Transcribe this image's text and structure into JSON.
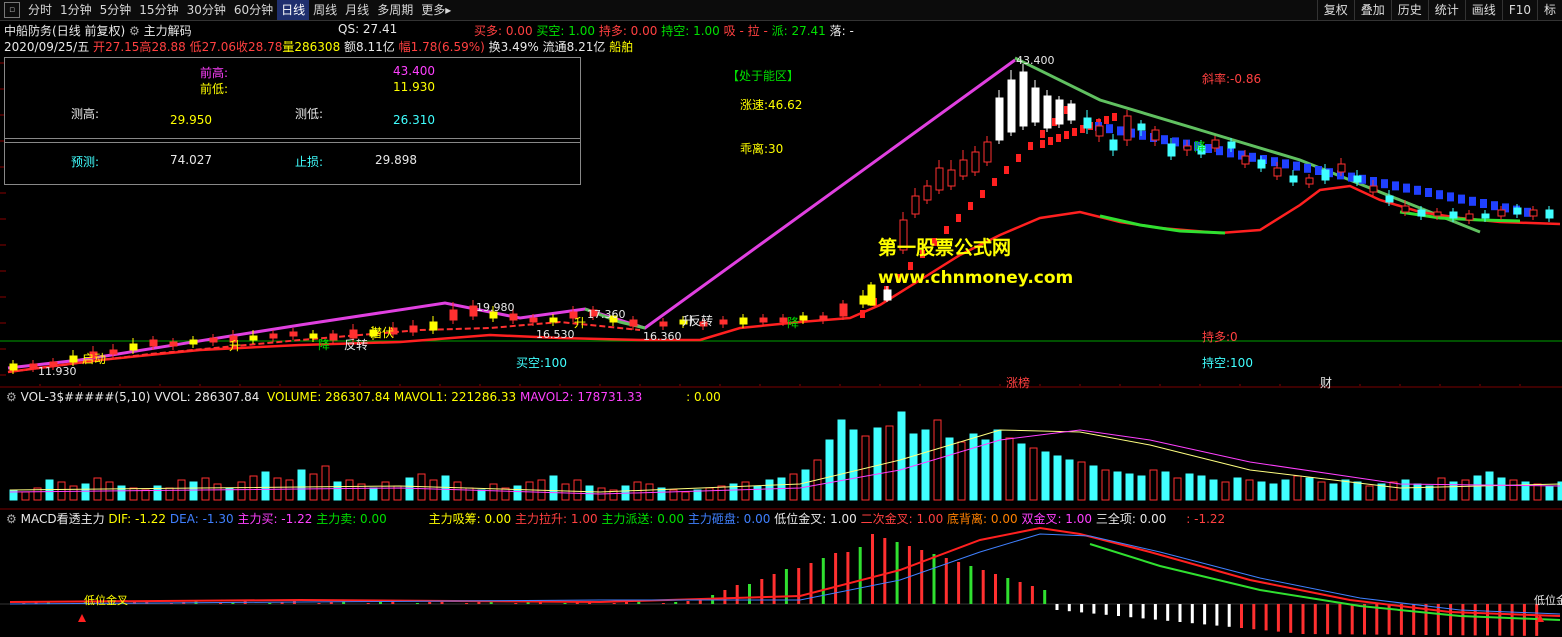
{
  "toolbar": {
    "timeframes": [
      "分时",
      "1分钟",
      "5分钟",
      "15分钟",
      "30分钟",
      "60分钟",
      "日线",
      "周线",
      "月线",
      "多周期",
      "更多▸"
    ],
    "active": "日线",
    "right": [
      "复权",
      "叠加",
      "历史",
      "统计",
      "画线",
      "F10",
      "标"
    ]
  },
  "header": {
    "stock": "中船防务",
    "mode": "(日线 前复权)",
    "indicator": "主力解码",
    "qs": "QS: 27.41",
    "buy_more": "买多: 0.00",
    "buy_empty": "买空: 1.00",
    "hold_more": "持多: 0.00",
    "hold_empty": "持空: 1.00",
    "xi": "吸",
    "la": "拉",
    "pai": "派: 27.41",
    "luo": "落: -"
  },
  "quote": {
    "date": "2020/09/25/五",
    "open_l": "开",
    "open": "27.15",
    "high_l": "高",
    "high": "28.88",
    "low_l": "低",
    "low": "27.06",
    "close_l": "收",
    "close": "28.78",
    "vol_l": "量",
    "vol": "286308",
    "amt_l": "额",
    "amt": "8.11亿",
    "chg_l": "幅",
    "chg": "1.78(6.59%)",
    "turn_l": "换",
    "turn": "3.49%",
    "float_l": "流通",
    "float": "8.21亿",
    "sector": "船舶"
  },
  "panel": {
    "prev_high_label": "前高:",
    "prev_high": "43.400",
    "prev_low_label": "前低:",
    "prev_low": "11.930",
    "m_high_label": "测高:",
    "m_high": "29.950",
    "m_low_label": "测低:",
    "m_low": "26.310",
    "predict_label": "预测:",
    "predict": "74.027",
    "stop_label": "止损:",
    "stop": "29.898"
  },
  "chart_labels": {
    "zone": "【处于能区】",
    "speed": "涨速:46.62",
    "deviation": "乖离:30",
    "slope": "斜率:-0.86",
    "hold_more": "持多:0",
    "buy_empty": "买空:100",
    "hold_empty": "持空:100",
    "peak": "43.400",
    "p1": "19.980",
    "p2": "17.360",
    "p3": "16.530",
    "p4": "16.360",
    "p5": "11.930",
    "event1": "涨榜",
    "event2": "财",
    "t_fall": "下跌",
    "t_rise": "升",
    "t_turn": "反转",
    "t_drop": "降",
    "t_latent": "潜伏",
    "t_buy": "买",
    "t_start": "启动"
  },
  "watermark": {
    "line1": "第一股票公式网",
    "line2": "www.chnmoney.com"
  },
  "vol_panel": {
    "name": "VOL-3$#####(5,10)",
    "vvol": "VVOL: 286307.84",
    "volume": "VOLUME: 286307.84",
    "mavol1": "MAVOL1: 221286.33",
    "mavol2": "MAVOL2: 178731.33",
    "extra": ": 0.00"
  },
  "macd_panel": {
    "name": "MACD看透主力",
    "dif": "DIF: -1.22",
    "dea": "DEA: -1.30",
    "zl_buy": "主力买: -1.22",
    "zl_sell": "主力卖: 0.00",
    "xichou": "主力吸筹: 0.00",
    "lasheng": "主力拉升: 1.00",
    "paisong": "主力派送: 0.00",
    "zapan": "主力砸盘: 0.00",
    "low_gold": "低位金叉: 1.00",
    "second_gold": "二次金叉: 1.00",
    "bottom_div": "底背离: 0.00",
    "double_gold": "双金叉: 1.00",
    "full": "三全项: 0.00",
    "last": ": -1.22",
    "tag_left": "低位金叉",
    "tag_right": "低位金"
  }
}
